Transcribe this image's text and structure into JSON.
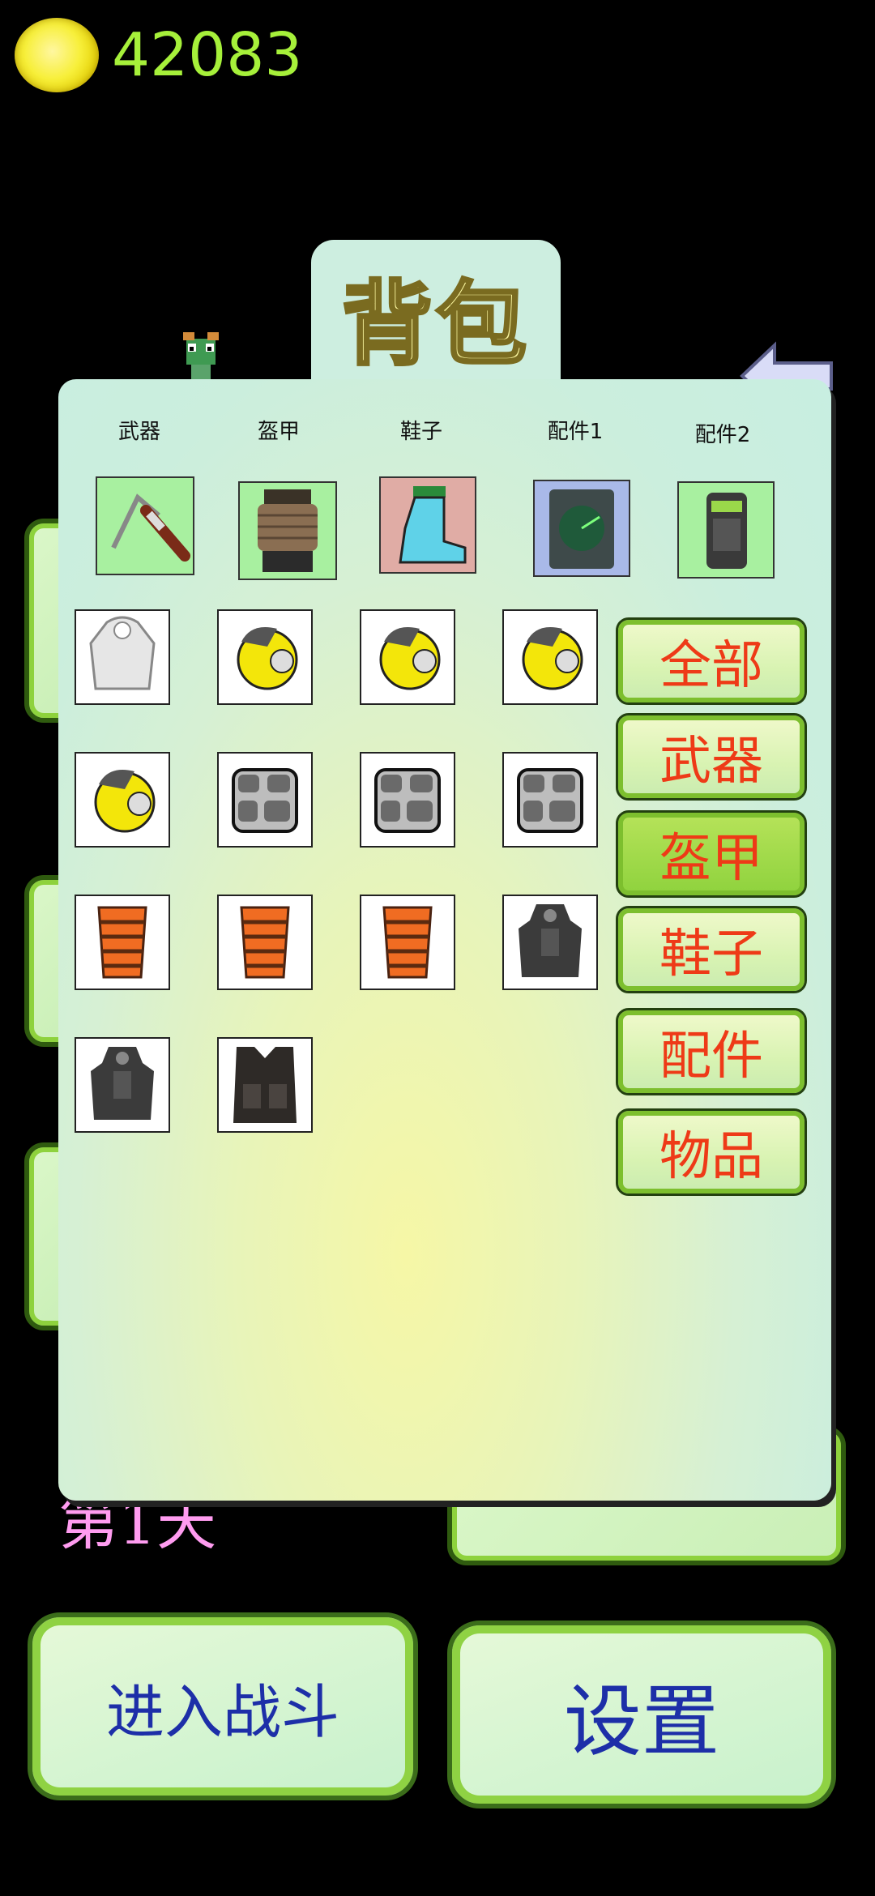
{
  "header": {
    "coins": "42083"
  },
  "background": {
    "day_text": "第1天"
  },
  "panel": {
    "title": "背包",
    "equip_slots": [
      "武器",
      "盔甲",
      "鞋子",
      "配件1",
      "配件2"
    ],
    "categories": [
      {
        "label": "全部",
        "active": false
      },
      {
        "label": "武器",
        "active": false
      },
      {
        "label": "盔甲",
        "active": true
      },
      {
        "label": "鞋子",
        "active": false
      },
      {
        "label": "配件",
        "active": false
      },
      {
        "label": "物品",
        "active": false
      }
    ],
    "inventory_item_count": 14
  },
  "bottom": {
    "battle_label": "进入战斗",
    "settings_label": "设置"
  },
  "colors": {
    "coin_text": "#a6f03a",
    "category_text": "#ee3a17",
    "bottom_text": "#1d2fa8"
  }
}
